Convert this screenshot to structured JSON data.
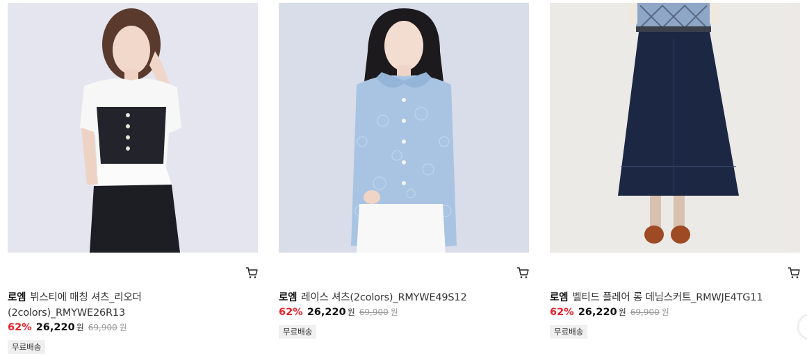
{
  "products": [
    {
      "brand": "로엠",
      "name": "뷔스티에 매칭 셔츠_리오더 (2colors)_RMYWE26R13",
      "discount": "62%",
      "price": "26,220",
      "currency": "원",
      "original_price": "69,900",
      "original_currency": "원",
      "badge": "무료배송",
      "image_icon": "product-photo-bustier-shirt"
    },
    {
      "brand": "로엠",
      "name": "레이스 셔츠(2colors)_RMYWE49S12",
      "discount": "62%",
      "price": "26,220",
      "currency": "원",
      "original_price": "69,900",
      "original_currency": "원",
      "badge": "무료배송",
      "image_icon": "product-photo-lace-shirt"
    },
    {
      "brand": "로엠",
      "name": "벨티드 플레어 롱 데님스커트_RMWJE4TG11",
      "discount": "62%",
      "price": "26,220",
      "currency": "원",
      "original_price": "69,900",
      "original_currency": "원",
      "badge": "무료배송",
      "image_icon": "product-photo-denim-skirt"
    }
  ],
  "colors": {
    "discount": "#e8202a",
    "badge_bg": "#f0f0f0",
    "photo_bg_1": "#e4e5ef",
    "photo_bg_2": "#d9dde9",
    "photo_bg_3": "#eceae7"
  }
}
